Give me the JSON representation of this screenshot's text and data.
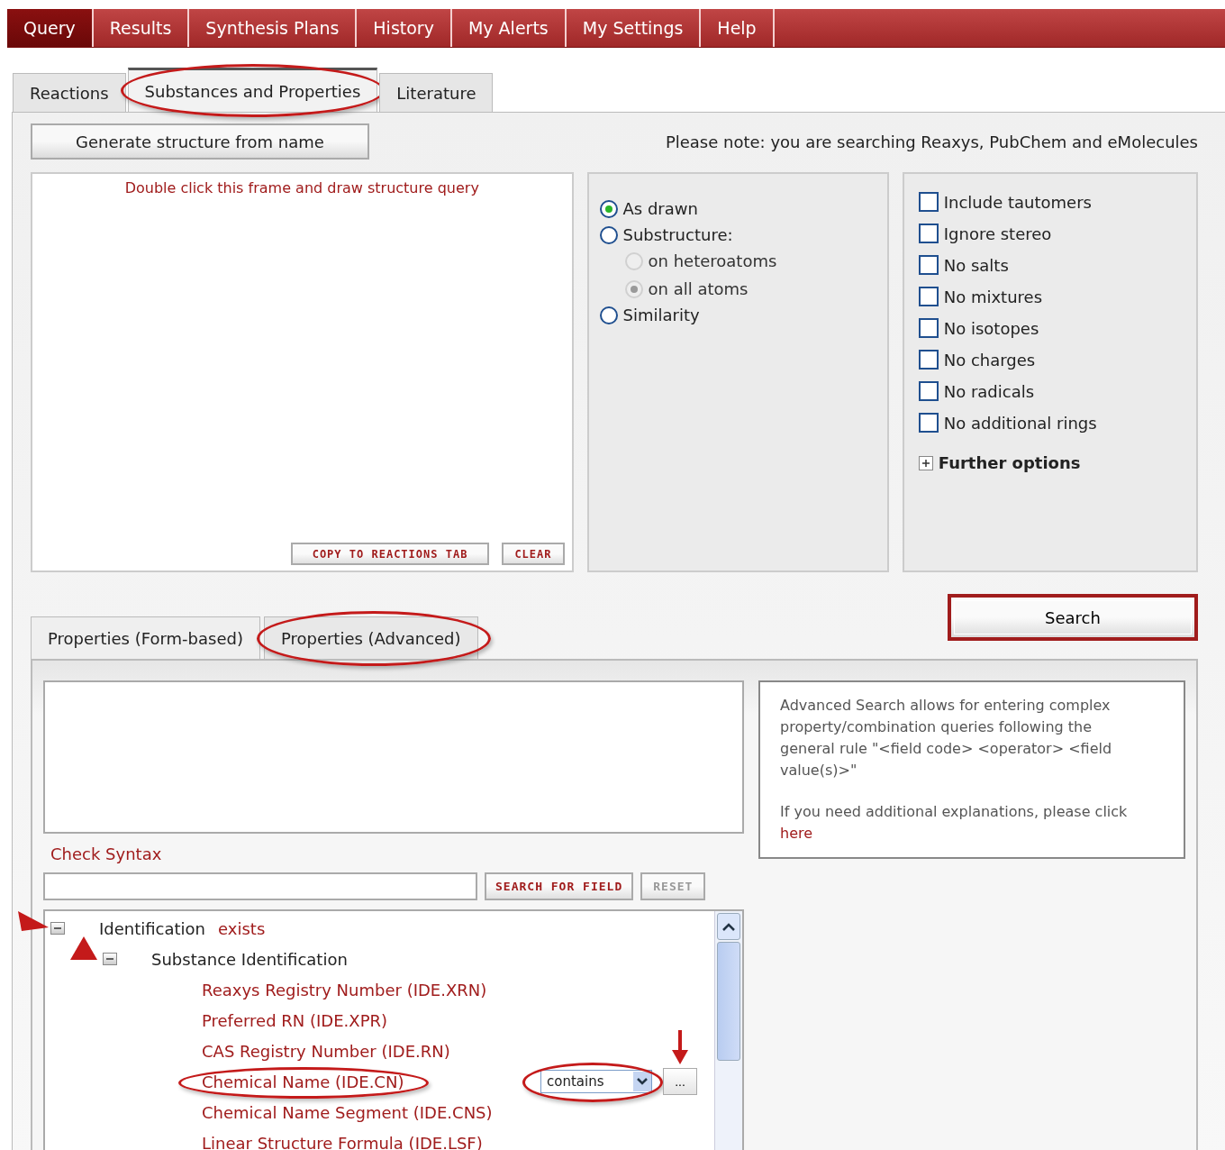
{
  "nav": [
    {
      "label": "Query",
      "selected": true
    },
    {
      "label": "Results",
      "selected": false
    },
    {
      "label": "Synthesis Plans",
      "selected": false
    },
    {
      "label": "History",
      "selected": false
    },
    {
      "label": "My Alerts",
      "selected": false
    },
    {
      "label": "My Settings",
      "selected": false
    },
    {
      "label": "Help",
      "selected": false
    }
  ],
  "search_tabs": [
    {
      "label": "Reactions",
      "selected": false,
      "highlighted": false
    },
    {
      "label": "Substances and Properties",
      "selected": true,
      "highlighted": true
    },
    {
      "label": "Literature",
      "selected": false,
      "highlighted": false
    }
  ],
  "generate_button": "Generate structure from name",
  "note": "Please note: you are searching Reaxys, PubChem and eMolecules",
  "editor": {
    "hint": "Double click this frame and draw structure query",
    "buttons": [
      "COPY TO REACTIONS TAB",
      "CLEAR"
    ]
  },
  "match_options": [
    {
      "label": "As drawn",
      "selected": true,
      "disabled": false
    },
    {
      "label": "Substructure:",
      "selected": false,
      "disabled": false,
      "children": [
        {
          "label": "on heteroatoms",
          "selected": false,
          "disabled": true
        },
        {
          "label": "on all atoms",
          "selected": true,
          "disabled": true
        }
      ]
    },
    {
      "label": "Similarity",
      "selected": false,
      "disabled": false
    }
  ],
  "filters": [
    {
      "label": "Include tautomers",
      "checked": false
    },
    {
      "label": "Ignore stereo",
      "checked": false
    },
    {
      "label": "No salts",
      "checked": false
    },
    {
      "label": "No mixtures",
      "checked": false
    },
    {
      "label": "No isotopes",
      "checked": false
    },
    {
      "label": "No charges",
      "checked": false
    },
    {
      "label": "No radicals",
      "checked": false
    },
    {
      "label": "No additional rings",
      "checked": false
    }
  ],
  "further_options": {
    "label": "Further options",
    "expanded": false
  },
  "search_button": {
    "label": "Search",
    "highlighted": true
  },
  "property_tabs": [
    {
      "label": "Properties (Form-based)",
      "selected": false,
      "highlighted": false
    },
    {
      "label": "Properties (Advanced)",
      "selected": true,
      "highlighted": true
    }
  ],
  "check_syntax": "Check Syntax",
  "info": {
    "text": "Advanced Search allows for entering complex property/combination queries following the general rule \"<field code> <operator> <field value(s)>\"",
    "more": "If you need additional explanations, please click",
    "link": "here"
  },
  "field_buttons": [
    {
      "label": "SEARCH FOR FIELD",
      "disabled": false
    },
    {
      "label": "RESET",
      "disabled": true
    }
  ],
  "tree": [
    {
      "label": "Identification",
      "suffix": "exists",
      "expanded": true,
      "arrow": true,
      "children": [
        {
          "label": "Substance Identification",
          "expanded": true,
          "arrow": true,
          "children": [
            {
              "label": "Reaxys Registry Number (IDE.XRN)",
              "highlighted": false
            },
            {
              "label": "Preferred RN (IDE.XPR)",
              "highlighted": false
            },
            {
              "label": "CAS Registry Number (IDE.RN)",
              "highlighted": false
            },
            {
              "label": "Chemical Name (IDE.CN)",
              "highlighted": true,
              "operator": {
                "value": "contains",
                "highlighted": true
              },
              "more_button": {
                "label": "...",
                "arrow": true
              }
            },
            {
              "label": "Chemical Name Segment (IDE.CNS)",
              "highlighted": false
            },
            {
              "label": "Linear Structure Formula (IDE.LSF)",
              "highlighted": false
            }
          ]
        }
      ]
    }
  ]
}
